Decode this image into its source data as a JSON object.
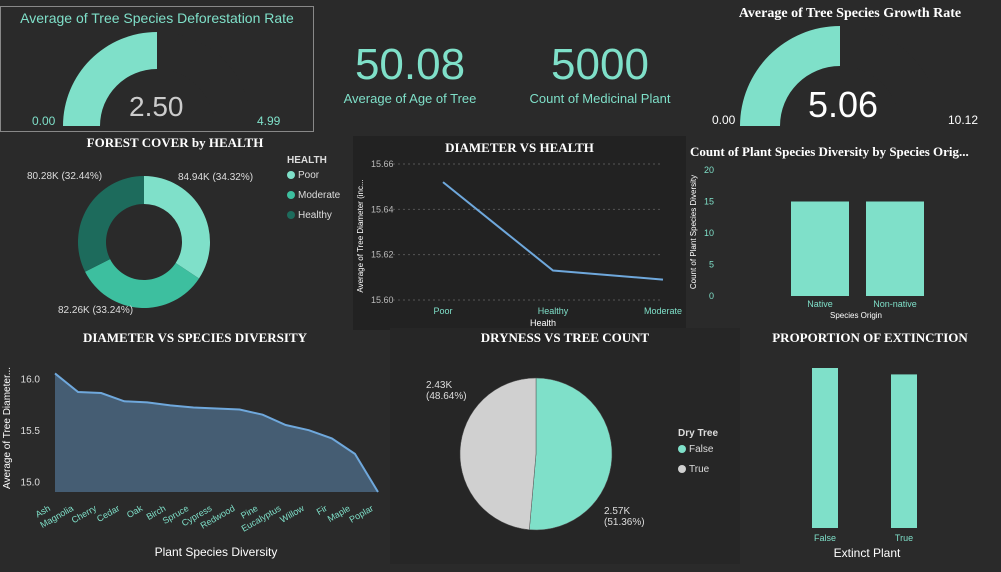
{
  "colors": {
    "teal": "#7fe0c9",
    "teal_mid": "#3dbf9f",
    "teal_dark": "#1d6b5c",
    "grey": "#d0d0d0",
    "line": "#6fa8dc",
    "area": "#4a6680"
  },
  "gauge_left": {
    "title": "Average of Tree Species Deforestation Rate",
    "value": "2.50",
    "min": "0.00",
    "max": "4.99",
    "fraction": 0.5
  },
  "kpi_age": {
    "value": "50.08",
    "caption": "Average of Age of Tree"
  },
  "kpi_medicinal": {
    "value": "5000",
    "caption": "Count of Medicinal Plant"
  },
  "gauge_right": {
    "title": "Average of Tree Species Growth Rate",
    "value": "5.06",
    "min": "0.00",
    "max": "10.12",
    "fraction": 0.5
  },
  "chart_data": [
    {
      "id": "forest",
      "type": "pie",
      "title": "FOREST COVER by HEALTH",
      "legend_title": "HEALTH",
      "categories": [
        "Poor",
        "Moderate",
        "Healthy"
      ],
      "values": [
        84.94,
        82.28,
        80.28
      ],
      "labels": [
        "84.94K (34.32%)",
        "82.26K (33.24%)",
        "80.28K (32.44%)"
      ]
    },
    {
      "id": "diam_health",
      "type": "line",
      "title": "DIAMETER VS HEALTH",
      "xlabel": "Health",
      "ylabel": "Average of Tree Diameter (inc...",
      "categories": [
        "Poor",
        "Healthy",
        "Moderate"
      ],
      "values": [
        15.652,
        15.613,
        15.609
      ],
      "ylim": [
        15.6,
        15.66
      ],
      "yticks": [
        "15.60",
        "15.62",
        "15.64",
        "15.66"
      ]
    },
    {
      "id": "diversity",
      "type": "bar",
      "title": "Count of Plant Species Diversity by Species Orig...",
      "xlabel": "Species Origin",
      "ylabel": "Count of Plant Species Diversity",
      "categories": [
        "Native",
        "Non-native"
      ],
      "values": [
        15,
        15
      ],
      "ylim": [
        0,
        20
      ],
      "yticks": [
        "0",
        "5",
        "10",
        "15",
        "20"
      ]
    },
    {
      "id": "diam_species",
      "type": "area",
      "title": "DIAMETER VS SPECIES DIVERSITY",
      "xlabel": "Plant Species Diversity",
      "ylabel": "Average of Tree Diameter...",
      "categories": [
        "Ash",
        "Magnolia",
        "Cherry",
        "Cedar",
        "Oak",
        "Birch",
        "Spruce",
        "Cypress",
        "Redwood",
        "Pine",
        "Eucalyptus",
        "Willow",
        "Fir",
        "Maple",
        "Poplar"
      ],
      "values": [
        16.05,
        15.87,
        15.86,
        15.78,
        15.77,
        15.74,
        15.72,
        15.71,
        15.7,
        15.65,
        15.55,
        15.5,
        15.42,
        15.27,
        14.9
      ],
      "ylim": [
        14.9,
        16.2
      ],
      "yticks": [
        "15.0",
        "15.5",
        "16.0"
      ]
    },
    {
      "id": "dryness",
      "type": "pie",
      "title": "DRYNESS VS TREE COUNT",
      "legend_title": "Dry Tree",
      "categories": [
        "False",
        "True"
      ],
      "values": [
        2.57,
        2.43
      ],
      "labels": [
        "2.57K (51.36%)",
        "2.43K (48.64%)"
      ]
    },
    {
      "id": "extinction",
      "type": "bar",
      "title": "PROPORTION OF EXTINCTION",
      "xlabel": "Extinct Plant",
      "categories": [
        "False",
        "True"
      ],
      "values": [
        1.0,
        0.96
      ]
    }
  ]
}
